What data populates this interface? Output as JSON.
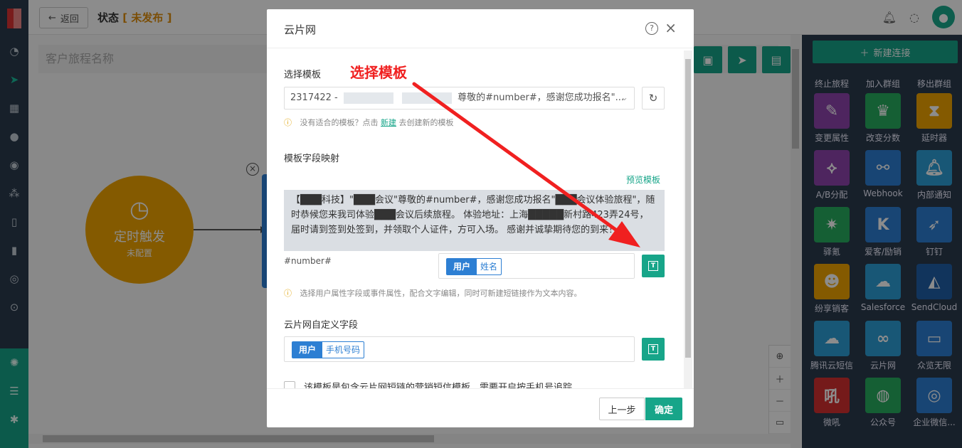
{
  "topbar": {
    "back_label": "返回",
    "status_label": "状态",
    "status_value": "未发布"
  },
  "canvas": {
    "name_placeholder": "客户旅程名称",
    "trigger_node": {
      "title": "定时触发",
      "subtitle": "未配置"
    }
  },
  "right_panel": {
    "new_connection": "新建连接",
    "text_items": [
      "终止旅程",
      "加入群组",
      "移出群组"
    ],
    "tiles": [
      {
        "label": "变更属性",
        "icon": "edit-icon",
        "color": "#8e44ad"
      },
      {
        "label": "改变分数",
        "icon": "trophy-icon",
        "color": "#27ae60"
      },
      {
        "label": "延时器",
        "icon": "hourglass-icon",
        "color": "#f0a500"
      },
      {
        "label": "A/B分配",
        "icon": "flow-icon",
        "color": "#8e44ad"
      },
      {
        "label": "Webhook",
        "icon": "webhook-icon",
        "color": "#2d7fd3"
      },
      {
        "label": "内部通知",
        "icon": "bell-icon",
        "color": "#2d9fd8"
      },
      {
        "label": "驿氪",
        "icon": "spider-icon",
        "color": "#27ae60"
      },
      {
        "label": "爱客/励销",
        "icon": "k-icon",
        "color": "#2d7fd3"
      },
      {
        "label": "钉钉",
        "icon": "dingtalk-icon",
        "color": "#2d7fd3"
      },
      {
        "label": "纷享销客",
        "icon": "robot-icon",
        "color": "#f0a500"
      },
      {
        "label": "Salesforce",
        "icon": "cloud-icon",
        "color": "#2d9fd8"
      },
      {
        "label": "SendCloud",
        "icon": "sendcloud-icon",
        "color": "#1f5fa8"
      },
      {
        "label": "腾讯云短信",
        "icon": "cloud-sms-icon",
        "color": "#2d9fd8"
      },
      {
        "label": "云片网",
        "icon": "yunpian-icon",
        "color": "#2d9fd8"
      },
      {
        "label": "众览无限",
        "icon": "zl-icon",
        "color": "#2d7fd3"
      },
      {
        "label": "微吼",
        "icon": "weihou-icon",
        "color": "#d63031"
      },
      {
        "label": "公众号",
        "icon": "wechat-icon",
        "color": "#27ae60"
      },
      {
        "label": "企业微信...",
        "icon": "wecom-icon",
        "color": "#2d7fd3"
      }
    ]
  },
  "modal": {
    "title": "云片网",
    "template_label": "选择模板",
    "template_select_prefix": "2317422 -",
    "template_select_suffix": "尊敬的#number#，感谢您成功报名\"...",
    "no_template_hint_before": "没有适合的模板？点击",
    "no_template_hint_link": "新建",
    "no_template_hint_after": "去创建新的模板",
    "mapping_label": "模板字段映射",
    "preview_link": "预览模板",
    "preview_text": "【███科技】\"███会议\"尊敬的#number#，感谢您成功报名\"███会议体验旅程\"，随时恭候您来我司体验███会议后续旅程。 体验地址：上海█████新村路423弄24号，届时请到签到处签到，并领取个人证件，方可入场。 感谢并诚挚期待您的到来！",
    "field_name": "#number#",
    "field_tag": {
      "key": "用户",
      "value": "姓名"
    },
    "field_hint": "选择用户属性字段或事件属性，配合文字编辑，同时可新建短链接作为文本内容。",
    "custom_label": "云片网自定义字段",
    "custom_tag": {
      "key": "用户",
      "value": "手机号码"
    },
    "checkbox_label": "该模板是包含云片网短链的营销短信模板，需要开启按手机号追踪",
    "prev_button": "上一步",
    "ok_button": "确定"
  },
  "annotation": {
    "text": "选择模板",
    "color": "#f02020"
  }
}
